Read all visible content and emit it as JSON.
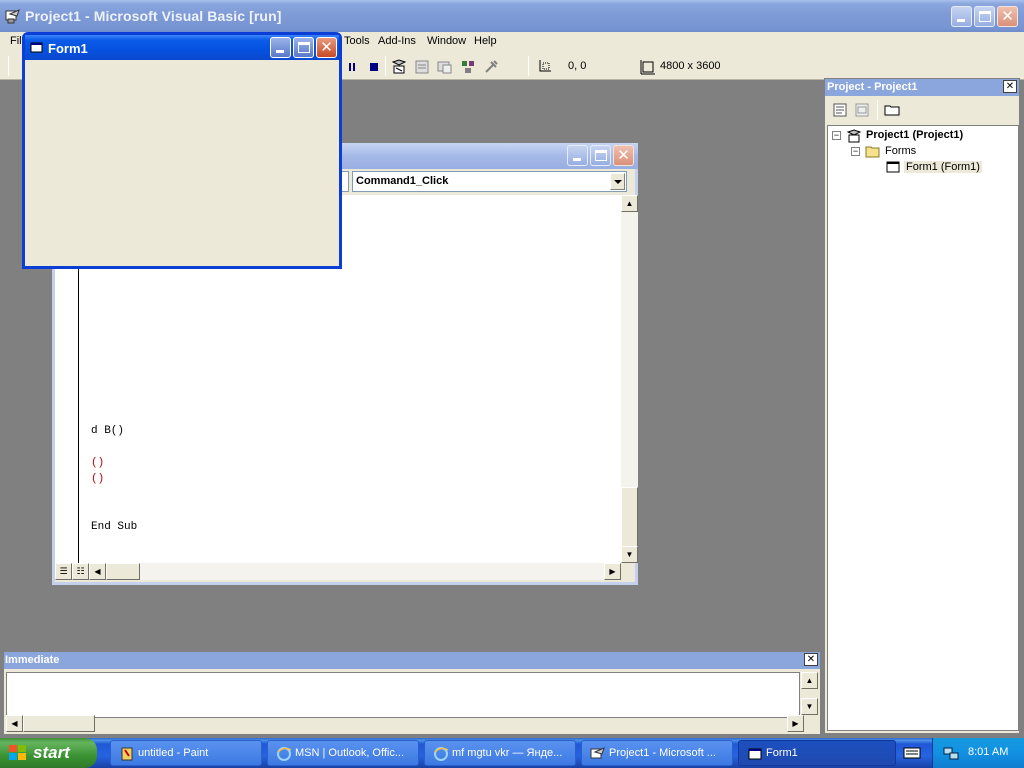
{
  "window": {
    "title": "Project1 - Microsoft Visual Basic [run]"
  },
  "menu": {
    "items": [
      "File",
      "Tools",
      "Add-Ins",
      "Window",
      "Help"
    ]
  },
  "toolbar": {
    "position": "0, 0",
    "size": "4800 x 3600"
  },
  "form_window": {
    "title": "Form1"
  },
  "code_window": {
    "procedure": "Command1_Click",
    "lines": [
      "d B()",
      "()",
      "()",
      "End Sub"
    ]
  },
  "project_explorer": {
    "title": "Project - Project1",
    "tree": {
      "project": "Project1 (Project1)",
      "folder": "Forms",
      "form": "Form1 (Form1)"
    }
  },
  "immediate": {
    "title": "Immediate"
  },
  "taskbar": {
    "start": "start",
    "tasks": [
      "untitled - Paint",
      "MSN | Outlook, Offic...",
      "mf mgtu vkr — Янде...",
      "Project1 - Microsoft ...",
      "Form1"
    ],
    "clock": "8:01 AM"
  },
  "colors": {
    "accent": "#0a3ed6",
    "title_inactive": "#8aa6dd",
    "code_red": "#c00000"
  }
}
